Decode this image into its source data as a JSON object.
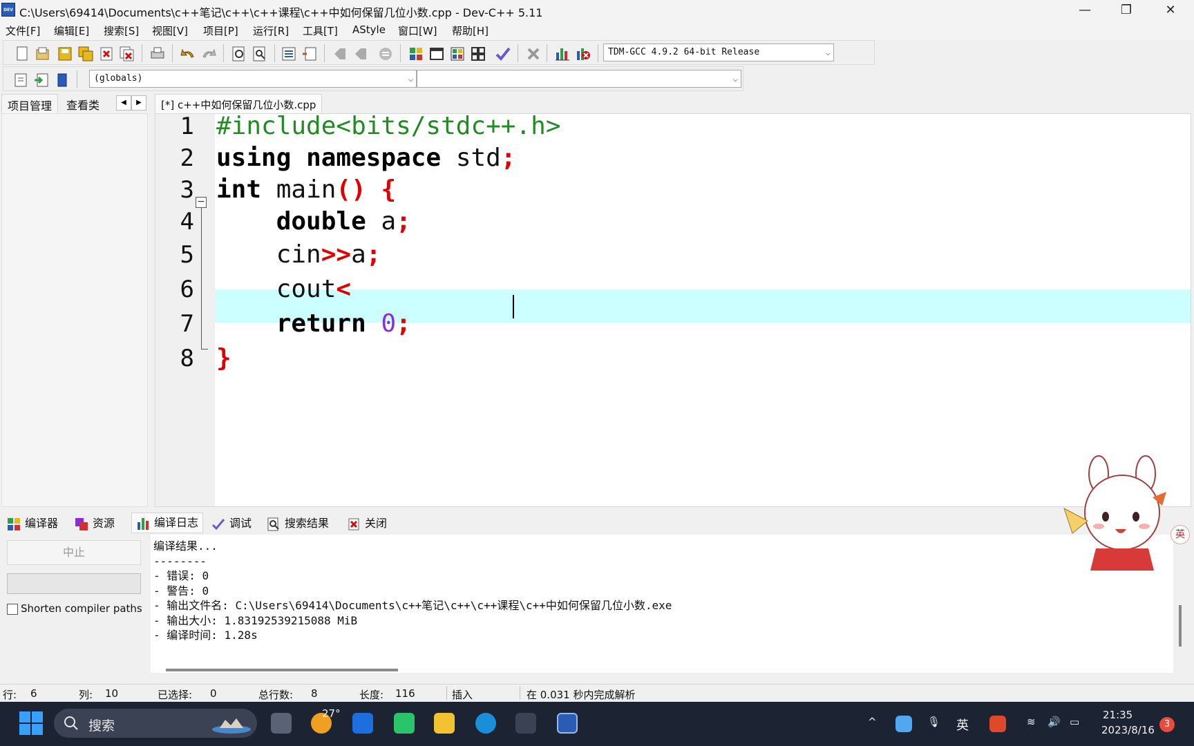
{
  "window": {
    "title": "C:\\Users\\69414\\Documents\\c++笔记\\c++\\c++课程\\c++中如何保留几位小数.cpp - Dev-C++ 5.11",
    "app_icon_text": "DEV"
  },
  "menu": [
    "文件[F]",
    "编辑[E]",
    "搜索[S]",
    "视图[V]",
    "项目[P]",
    "运行[R]",
    "工具[T]",
    "AStyle",
    "窗口[W]",
    "帮助[H]"
  ],
  "toolbar": {
    "compiler_select": "TDM-GCC 4.9.2 64-bit Release",
    "scope_select": "(globals)",
    "function_select": ""
  },
  "left_panel": {
    "tabs": [
      "项目管理",
      "查看类"
    ]
  },
  "editor": {
    "tab_label": "[*] c++中如何保留几位小数.cpp",
    "lines": [
      {
        "num": "1",
        "text": "#include<bits/stdc++.h>"
      },
      {
        "num": "2",
        "text": "using namespace std;"
      },
      {
        "num": "3",
        "text": "int main() {"
      },
      {
        "num": "4",
        "text": "    double a;"
      },
      {
        "num": "5",
        "text": "    cin>>a;"
      },
      {
        "num": "6",
        "text": "    cout<"
      },
      {
        "num": "7",
        "text": "    return 0;"
      },
      {
        "num": "8",
        "text": "}"
      }
    ],
    "active_line": 6
  },
  "bottom_tabs": [
    "编译器",
    "资源",
    "编译日志",
    "调试",
    "搜索结果",
    "关闭"
  ],
  "bottom_panel": {
    "stop_label": "中止",
    "shorten_label": "Shorten compiler paths",
    "log_lines": [
      "编译结果...",
      "--------",
      "- 错误: 0",
      "- 警告: 0",
      "- 输出文件名: C:\\Users\\69414\\Documents\\c++笔记\\c++\\c++课程\\c++中如何保留几位小数.exe",
      "- 输出大小: 1.83192539215088 MiB",
      "- 编译时间: 1.28s"
    ]
  },
  "status": {
    "row_label": "行:",
    "row_value": "6",
    "col_label": "列:",
    "col_value": "10",
    "sel_label": "已选择:",
    "sel_value": "0",
    "total_label": "总行数:",
    "total_value": "8",
    "len_label": "长度:",
    "len_value": "116",
    "mode": "插入",
    "parse_msg": "在 0.031 秒内完成解析"
  },
  "taskbar": {
    "search_label": "搜索",
    "weather": "27°",
    "ime": "英",
    "time": "21:35",
    "date": "2023/8/16",
    "notifications": "3"
  },
  "mascot": {
    "ime_bubble": "英"
  },
  "colors": {
    "keyword": "#000000",
    "preprocessor": "#228b22",
    "symbol": "#e00000",
    "number": "#8a2be2",
    "active_line": "#ccffff",
    "taskbar_bg": "#1c2433"
  }
}
